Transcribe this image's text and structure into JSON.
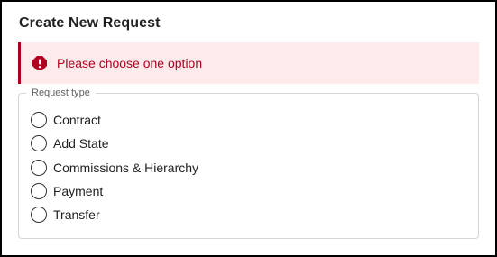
{
  "dialog": {
    "title": "Create New Request"
  },
  "alert": {
    "icon": "error-icon",
    "message": "Please choose one option",
    "color": "#b00020",
    "background": "#fdeaea"
  },
  "request_type": {
    "legend": "Request type",
    "options": [
      {
        "label": "Contract",
        "selected": false
      },
      {
        "label": "Add State",
        "selected": false
      },
      {
        "label": "Commissions & Hierarchy",
        "selected": false
      },
      {
        "label": "Payment",
        "selected": false
      },
      {
        "label": "Transfer",
        "selected": false
      }
    ]
  }
}
